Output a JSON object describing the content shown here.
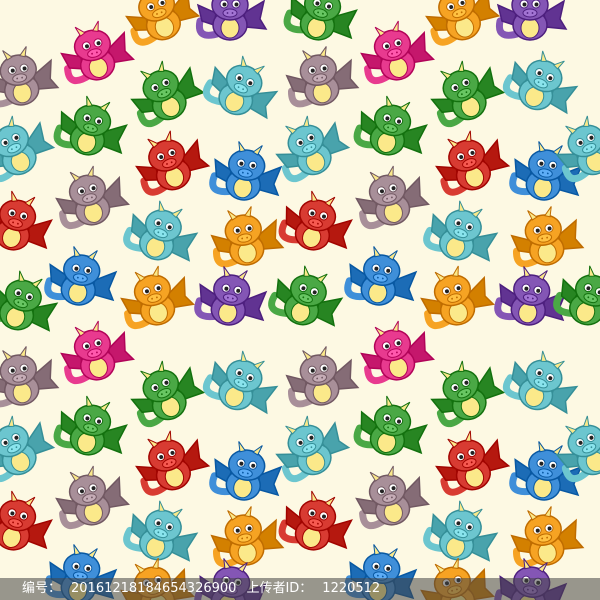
{
  "colors": {
    "background": "#fdf9e3",
    "pink": "#e83a8f",
    "blue": "#3f8fd9",
    "teal": "#6cc6cf",
    "green": "#4aa845",
    "orange": "#f6a323",
    "purple": "#8456b5",
    "grey": "#a88f99",
    "red": "#d83b32",
    "belly": "#fbe98a"
  },
  "pattern": {
    "subject": "dragon",
    "icon": "dragon-icon"
  },
  "watermark": {
    "id_label": "编号：",
    "id_value": "20161218184654326900",
    "uploader_label": "上传者ID：",
    "uploader_value": "1220512"
  }
}
